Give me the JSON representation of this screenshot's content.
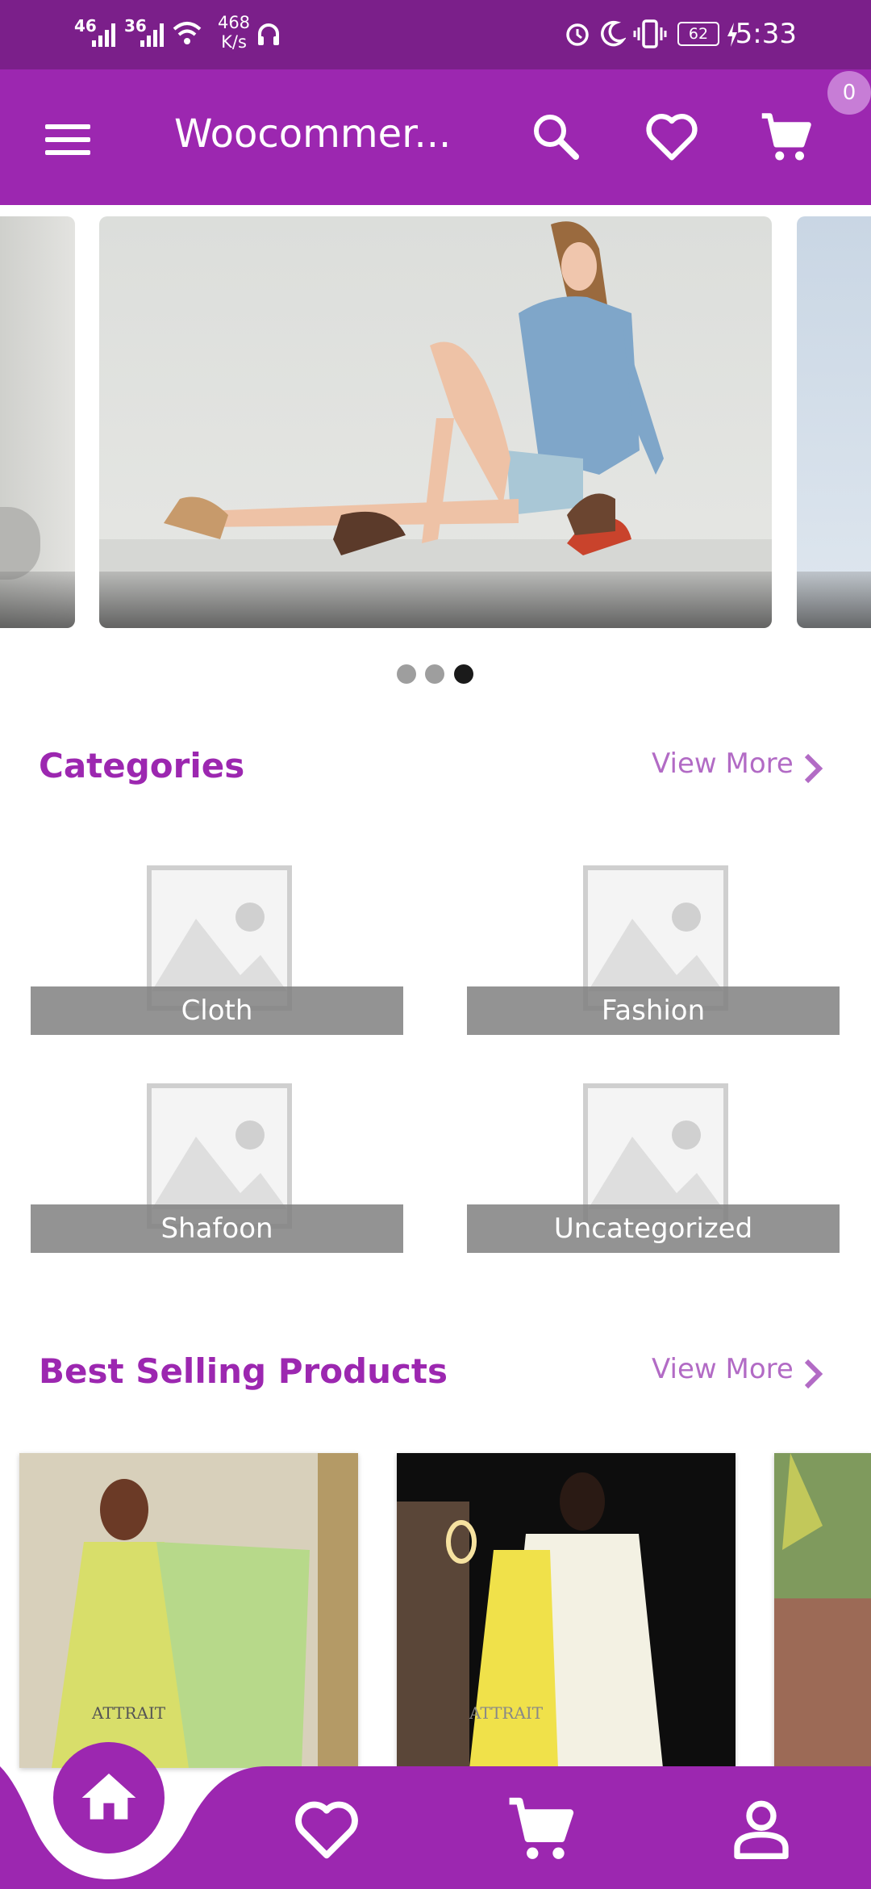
{
  "status_bar": {
    "signal_1": "46",
    "signal_2": "36",
    "net_speed_value": "468",
    "net_speed_unit": "K/s",
    "battery": "62",
    "time": "5:33"
  },
  "app_bar": {
    "title": "Woocommer...",
    "cart_count": "0"
  },
  "carousel": {
    "slide_count": 3,
    "active_index": 2
  },
  "categories": {
    "title": "Categories",
    "view_more": "View More",
    "items": [
      {
        "label": "Cloth"
      },
      {
        "label": "Fashion"
      },
      {
        "label": "Shafoon"
      },
      {
        "label": "Uncategorized"
      }
    ]
  },
  "best_selling": {
    "title": "Best Selling Products",
    "view_more": "View More",
    "products": [
      {
        "caption": "ATTRAIT"
      },
      {
        "caption": "ATTRAIT"
      }
    ]
  },
  "colors": {
    "status_bar": "#7b1f8a",
    "primary": "#9c27b0",
    "accent_light": "#b26bc5"
  },
  "bottom_nav": {
    "items": [
      "home-icon",
      "heart-icon",
      "cart-icon",
      "person-icon"
    ],
    "active": "home-icon"
  }
}
